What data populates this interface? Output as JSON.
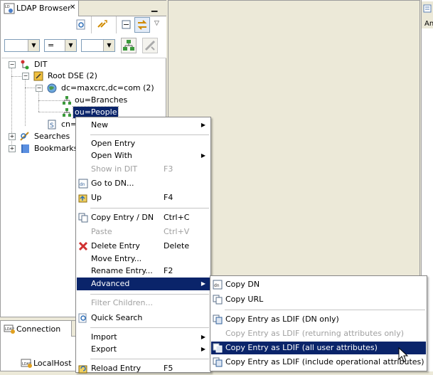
{
  "ldap_browser": {
    "tab_label": "LDAP Browser",
    "tab_close": "✕",
    "filter": {
      "combo1_value": "",
      "combo2_value": "=",
      "combo3_value": ""
    },
    "tree": [
      {
        "label": "DIT"
      },
      {
        "label": "Root DSE (2)"
      },
      {
        "label": "dc=maxcrc,dc=com (2)"
      },
      {
        "label": "ou=Branches"
      },
      {
        "label": "ou=People"
      },
      {
        "label": "cn="
      },
      {
        "label": "Searches"
      },
      {
        "label": "Bookmarks"
      }
    ]
  },
  "right_view": {
    "label": "An"
  },
  "connections": {
    "tab_label": "Connection",
    "items": [
      {
        "label": "LocalHost"
      }
    ]
  },
  "context_menu": {
    "items": [
      {
        "label": "New",
        "accel": ""
      },
      {
        "label": "Open Entry",
        "accel": ""
      },
      {
        "label": "Open With",
        "accel": ""
      },
      {
        "label": "Show in DIT",
        "accel": "F3"
      },
      {
        "label": "Go to DN...",
        "accel": ""
      },
      {
        "label": "Up",
        "accel": "F4"
      },
      {
        "label": "Copy Entry / DN",
        "accel": "Ctrl+C"
      },
      {
        "label": "Paste",
        "accel": "Ctrl+V"
      },
      {
        "label": "Delete Entry",
        "accel": "Delete"
      },
      {
        "label": "Move Entry...",
        "accel": ""
      },
      {
        "label": "Rename Entry...",
        "accel": "F2"
      },
      {
        "label": "Advanced",
        "accel": ""
      },
      {
        "label": "Filter Children...",
        "accel": ""
      },
      {
        "label": "Quick Search",
        "accel": ""
      },
      {
        "label": "Import",
        "accel": ""
      },
      {
        "label": "Export",
        "accel": ""
      },
      {
        "label": "Reload Entry",
        "accel": "F5"
      }
    ]
  },
  "advanced_submenu": {
    "items": [
      {
        "label": "Copy DN"
      },
      {
        "label": "Copy URL"
      },
      {
        "label": "Copy Entry as LDIF (DN only)"
      },
      {
        "label": "Copy Entry as LDIF (returning attributes only)"
      },
      {
        "label": "Copy Entry as LDIF (all user attributes)"
      },
      {
        "label": "Copy Entry as LDIF (include operational attributes)"
      }
    ]
  },
  "colors": {
    "selection": "#0a246a",
    "chrome": "#ece9d8",
    "disabled_text": "#a0a0a0"
  }
}
